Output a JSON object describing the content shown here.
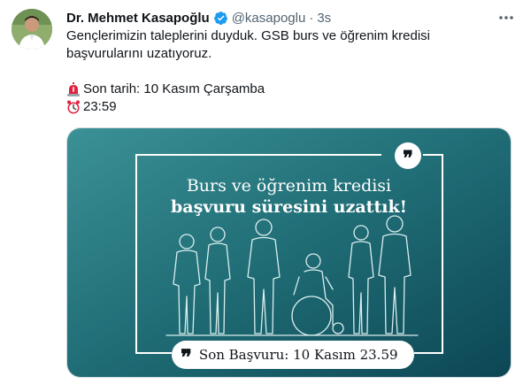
{
  "author": {
    "name": "Dr. Mehmet Kasapoğlu",
    "handle": "@kasapoglu",
    "separator": "·",
    "time": "3s"
  },
  "tweet": {
    "text": "Gençlerimizin taleplerini duyduk. GSB burs ve öğrenim kredisi başvurularını uzatıyoruz.",
    "deadline_line": "Son tarih: 10 Kasım Çarşamba",
    "time_line": "23:59",
    "icons": [
      "rotating-light-icon",
      "alarm-clock-icon"
    ]
  },
  "media": {
    "title_line1": "Burs ve öğrenim kredisi",
    "title_line2": "başvuru süresini uzattık!",
    "quote_mark": "❞",
    "deadline_quote": "❞",
    "deadline_text": "Son Başvuru: 10 Kasım 23.59",
    "bg_color_start": "#2b8287",
    "bg_color_end": "#0f4c57"
  },
  "colors": {
    "verified": "#1d9bf0",
    "secondary_text": "#536471",
    "primary_text": "#0f1419"
  }
}
